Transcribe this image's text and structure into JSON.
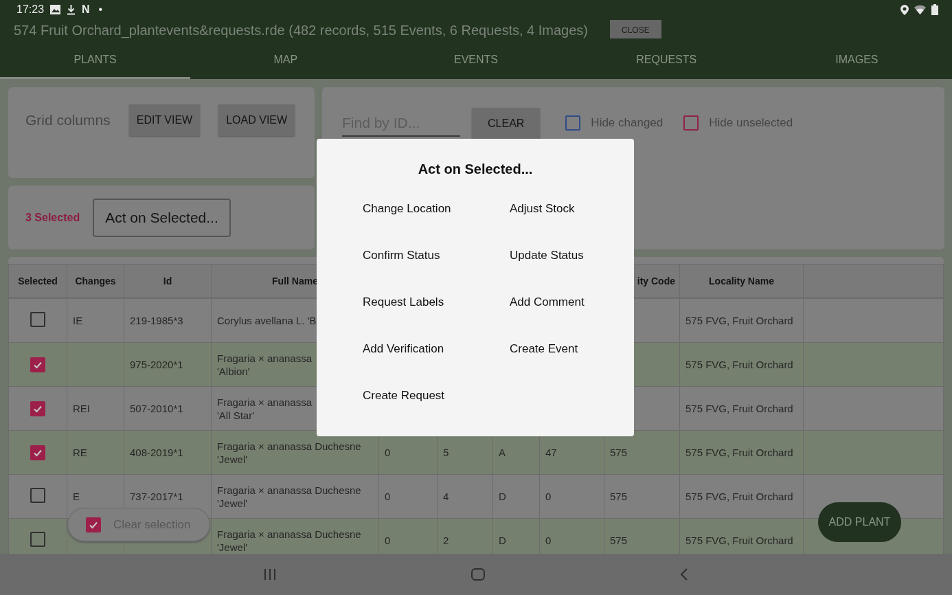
{
  "status_bar": {
    "time": "17:23",
    "notification_marks": [
      "N",
      "•"
    ]
  },
  "title_bar": {
    "title": "574 Fruit Orchard_plantevents&requests.rde (482 records, 515 Events, 6 Requests, 4 Images)",
    "close_button": "CLOSE"
  },
  "tabs": [
    {
      "label": "PLANTS",
      "selected": true
    },
    {
      "label": "MAP",
      "selected": false
    },
    {
      "label": "EVENTS",
      "selected": false
    },
    {
      "label": "REQUESTS",
      "selected": false
    },
    {
      "label": "IMAGES",
      "selected": false
    }
  ],
  "grid_panel": {
    "label": "Grid columns",
    "buttons": [
      "EDIT VIEW",
      "LOAD VIEW"
    ]
  },
  "filter_panel": {
    "search": {
      "placeholder": "Find by ID..."
    },
    "clear_button": "CLEAR",
    "checkboxes": [
      {
        "label": "Hide changed",
        "checked": false,
        "color": "#2f4c86"
      },
      {
        "label": "Hide unselected",
        "checked": false,
        "color": "#8e2447"
      }
    ]
  },
  "selection_panel": {
    "count": "3 Selected",
    "action_button": "Act on Selected..."
  },
  "table": {
    "columns": [
      {
        "label": "Selected"
      },
      {
        "label": "Changes"
      },
      {
        "label": "Id"
      },
      {
        "label": "Full Name"
      },
      {},
      {},
      {},
      {},
      {
        "label": "ity Code"
      },
      {
        "label": "Locality Name"
      },
      {}
    ],
    "rows": [
      {
        "selected": false,
        "changes": "IE",
        "id": "219-1985*3",
        "full_name": [
          "Corylus avellana L. 'B"
        ],
        "column_5": "",
        "column_6": "",
        "column_7": "",
        "column_8": "",
        "column_9": "",
        "locality_name": "575 FVG, Fruit Orchard"
      },
      {
        "selected": true,
        "id": "975-2020*1",
        "full_name": [
          "Fragaria × ananassa",
          "'Albion'"
        ],
        "locality_name": "575 FVG, Fruit Orchard"
      },
      {
        "selected": true,
        "changes": "REI",
        "id": "507-2010*1",
        "full_name": [
          "Fragaria × ananassa",
          "'All Star'"
        ],
        "locality_name": "575 FVG, Fruit Orchard"
      },
      {
        "selected": true,
        "changes": "RE",
        "id": "408-2019*1",
        "full_name": [
          "Fragaria × ananassa Duchesne",
          "'Jewel'"
        ],
        "column_5": "0",
        "column_6": "5",
        "column_7": "A",
        "column_8": "47",
        "column_9": "575",
        "locality_name": "575 FVG, Fruit Orchard"
      },
      {
        "selected": false,
        "changes": "E",
        "id": "737-2017*1",
        "full_name": [
          "Fragaria × ananassa Duchesne",
          "'Jewel'"
        ],
        "column_5": "0",
        "column_6": "4",
        "column_7": "D",
        "column_8": "0",
        "column_9": "575",
        "locality_name": "575 FVG, Fruit Orchard"
      },
      {
        "selected": false,
        "id": "",
        "full_name": [
          "Fragaria × ananassa Duchesne",
          "'Jewel'"
        ],
        "column_5": "0",
        "column_6": "2",
        "column_7": "D",
        "column_8": "0",
        "column_9": "575",
        "locality_name": "575 FVG, Fruit Orchard"
      }
    ]
  },
  "clear_selection_chip": {
    "label": "Clear selection",
    "checked": true
  },
  "add_button": "ADD PLANT",
  "dialog": {
    "title": "Act on Selected...",
    "options": [
      "Change Location",
      "Adjust Stock",
      "Confirm Status",
      "Update Status",
      "Request Labels",
      "Add Comment",
      "Add Verification",
      "Create Event",
      "Create Request"
    ]
  }
}
